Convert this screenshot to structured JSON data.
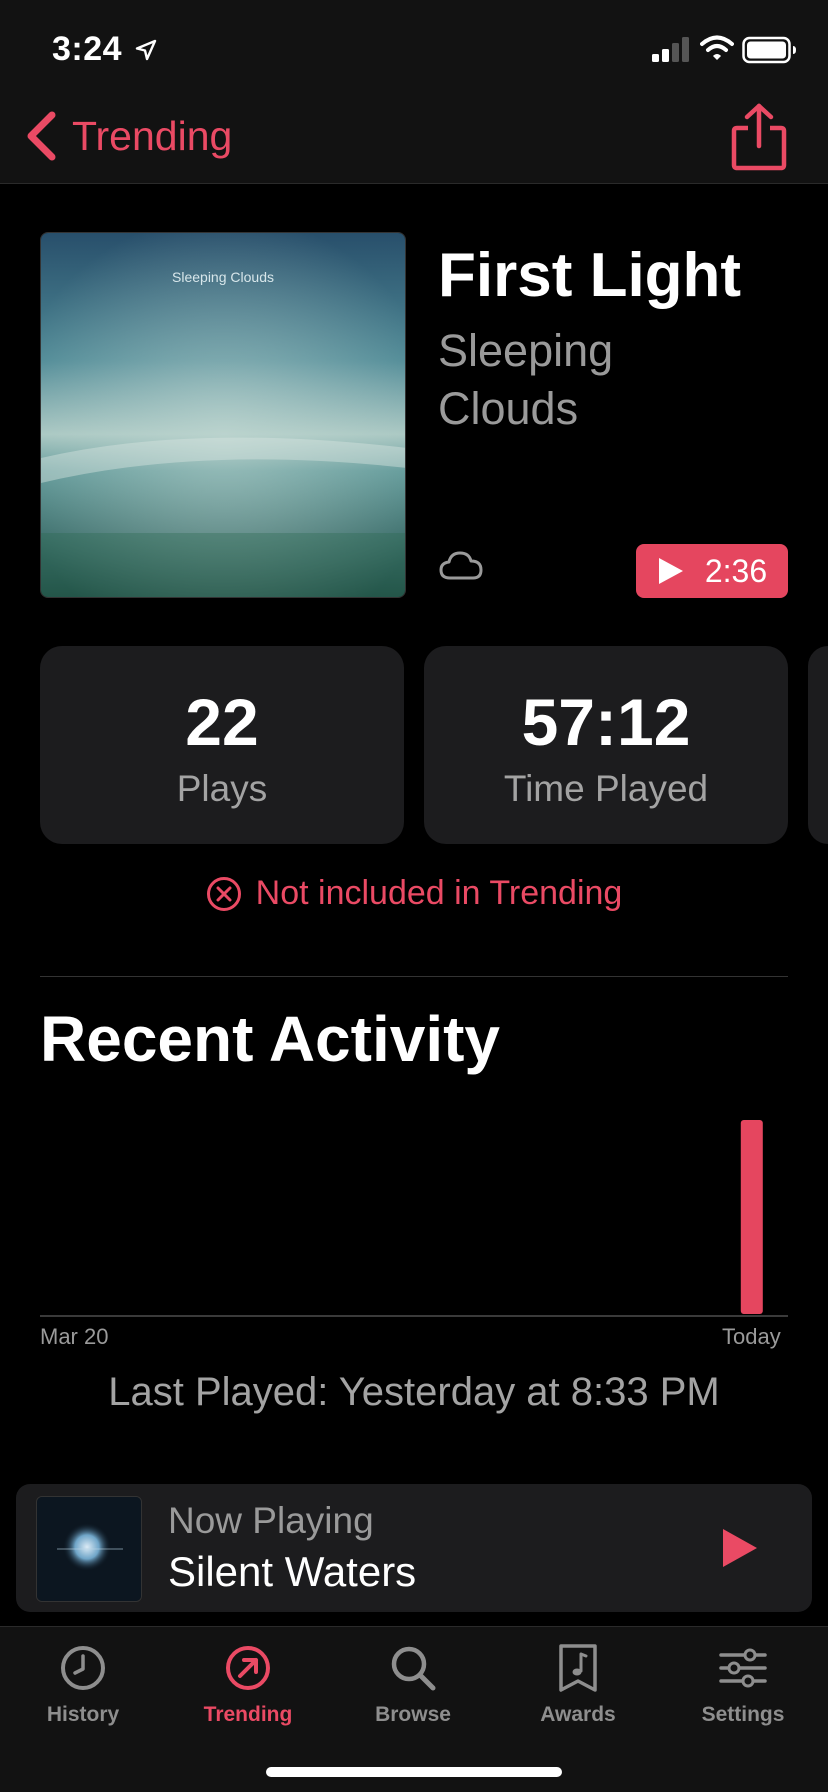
{
  "status_bar": {
    "time": "3:24"
  },
  "nav": {
    "back_label": "Trending",
    "share_icon": "share-icon"
  },
  "track": {
    "title": "First Light",
    "artist": "Sleeping Clouds",
    "album_art_text": "Sleeping Clouds",
    "preview_duration": "2:36"
  },
  "stats": [
    {
      "value": "22",
      "label": "Plays"
    },
    {
      "value": "57:12",
      "label": "Time Played"
    }
  ],
  "trending_status": "Not included in Trending",
  "recent_activity": {
    "title": "Recent Activity",
    "last_played": "Last Played: Yesterday at 8:33 PM"
  },
  "chart_data": {
    "type": "bar",
    "x_start_label": "Mar 20",
    "x_end_label": "Today",
    "values": [
      0,
      0,
      0,
      0,
      0,
      0,
      0,
      0,
      0,
      0,
      0,
      0,
      0,
      0,
      0,
      0,
      0,
      0,
      0,
      0,
      0,
      0,
      0,
      0,
      0,
      0,
      0,
      0,
      0,
      22,
      0
    ],
    "bar_color": "#e5465f",
    "grid": false
  },
  "now_playing": {
    "label": "Now Playing",
    "title": "Silent Waters"
  },
  "tabs": [
    {
      "label": "History",
      "icon": "clock-icon",
      "active": false
    },
    {
      "label": "Trending",
      "icon": "trending-icon",
      "active": true
    },
    {
      "label": "Browse",
      "icon": "search-icon",
      "active": false
    },
    {
      "label": "Awards",
      "icon": "music-note-icon",
      "active": false
    },
    {
      "label": "Settings",
      "icon": "sliders-icon",
      "active": false
    }
  ],
  "colors": {
    "accent": "#ea4a64",
    "card": "#1c1c1e",
    "muted": "#a3a3a3"
  }
}
